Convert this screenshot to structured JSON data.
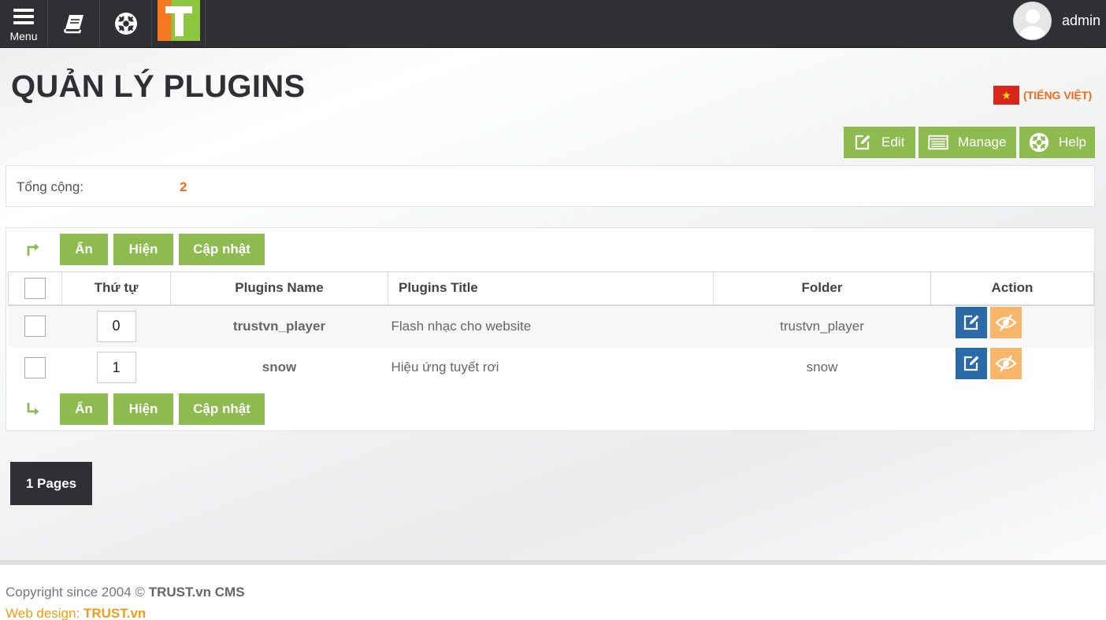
{
  "topbar": {
    "menu_label": "Menu",
    "username": "admin",
    "menu_icon": "hamburger-icon",
    "docs_icon": "book-icon",
    "help_icon": "lifebuoy-icon",
    "logo": "T"
  },
  "header": {
    "title": "QUẢN LÝ PLUGINS",
    "language_label": "(TIẾNG VIỆT)"
  },
  "toolbar": {
    "edit_label": "Edit",
    "manage_label": "Manage",
    "help_label": "Help"
  },
  "summary": {
    "total_label": "Tổng cộng:",
    "total_value": "2"
  },
  "actions": {
    "hide_label": "Ẩn",
    "show_label": "Hiện",
    "update_label": "Cập nhật"
  },
  "table": {
    "columns": [
      "",
      "Thứ tự",
      "Plugins Name",
      "Plugins Title",
      "Folder",
      "Action"
    ],
    "rows": [
      {
        "order": "0",
        "name": "trustvn_player",
        "title": "Flash nhạc cho website",
        "folder": "trustvn_player"
      },
      {
        "order": "1",
        "name": "snow",
        "title": "Hiệu ứng tuyết rơi",
        "folder": "snow"
      }
    ]
  },
  "pagination": {
    "label": "1 Pages"
  },
  "footer": {
    "copyright_prefix": "Copyright since 2004 ©",
    "copyright_brand": "TRUST.vn CMS",
    "webdesign_prefix": "Web design:",
    "webdesign_brand": "TRUST.vn"
  },
  "colors": {
    "topbar": "#2e3033",
    "green": "#8dbb4f",
    "orange": "#f06b22",
    "edit_blue": "#2a6aa8",
    "hide_orange": "#f9b66a"
  }
}
